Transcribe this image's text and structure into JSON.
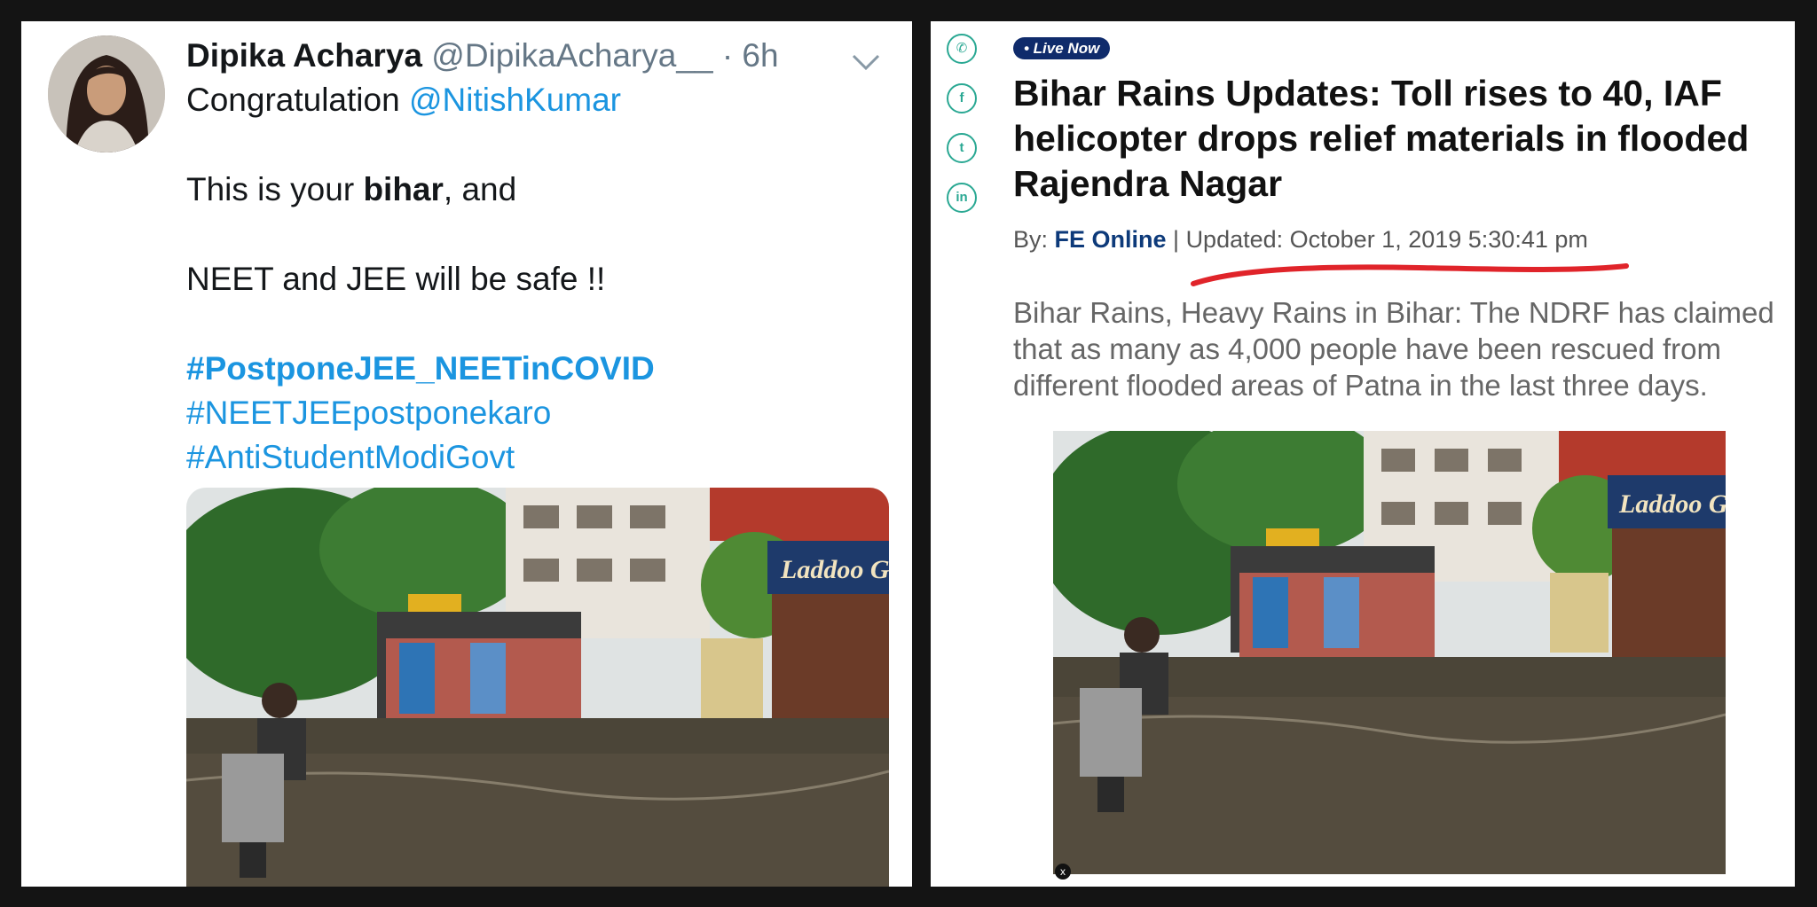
{
  "tweet": {
    "name": "Dipika Acharya",
    "handle": "@DipikaAcharya__",
    "dot": "·",
    "time": "6h",
    "line1_text": "Congratulation ",
    "mention": "@NitishKumar",
    "line2_pre": "This is your ",
    "line2_bold": "bihar",
    "line2_post": ", and",
    "line3": "NEET and JEE will be safe !!",
    "hashtags": [
      "#PostponeJEE_NEETinCOVID",
      "#NEETJEEpostponekaro",
      "#AntiStudentModiGovt"
    ],
    "photo_sign": "Laddoo G"
  },
  "article": {
    "share_icons": [
      "whatsapp-icon",
      "facebook-icon",
      "twitter-icon",
      "linkedin-icon"
    ],
    "share_glyphs": [
      "✆",
      "f",
      "t",
      "in"
    ],
    "live_badge": "• Live Now",
    "headline": "Bihar Rains Updates: Toll rises to 40, IAF helicopter drops relief materials in flooded Rajendra Nagar",
    "byline_prefix": "By: ",
    "author": "FE Online",
    "byline_sep": " | ",
    "updated": "Updated: October 1, 2019 5:30:41 pm",
    "summary": "Bihar Rains, Heavy Rains in Bihar: The NDRF has claimed that as many as 4,000 people have been rescued from different flooded areas of Patna in the last three days.",
    "photo_sign": "Laddoo Go",
    "close_glyph": "x"
  },
  "colors": {
    "background": "#141414",
    "link_blue": "#1b95e0",
    "share_green": "#2aa893",
    "badge_navy": "#0f2b6b",
    "underline_red": "#e0242a"
  }
}
